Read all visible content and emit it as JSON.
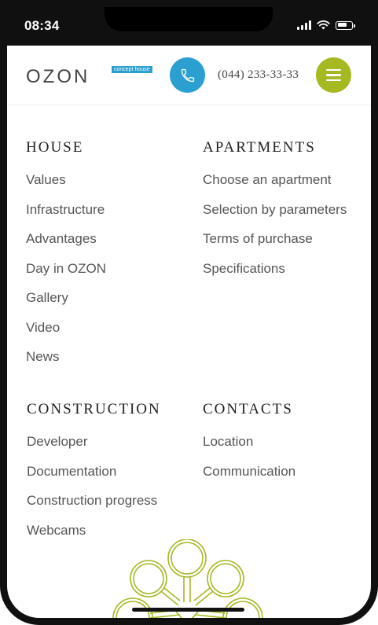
{
  "status_bar": {
    "time": "08:34"
  },
  "header": {
    "logo_text": "OZON",
    "logo_badge": "concept house",
    "phone": "(044) 233-33-33"
  },
  "sections": {
    "house": {
      "title": "HOUSE",
      "items": [
        "Values",
        "Infrastructure",
        "Advantages",
        "Day in OZON",
        "Gallery",
        "Video",
        "News"
      ]
    },
    "apartments": {
      "title": "APARTMENTS",
      "items": [
        "Choose an apartment",
        "Selection by parameters",
        "Terms of purchase",
        "Specifications"
      ]
    },
    "construction": {
      "title": "CONSTRUCTION",
      "items": [
        "Developer",
        "Documentation",
        "Construction progress",
        "Webcams"
      ]
    },
    "contacts": {
      "title": "CONTACTS",
      "items": [
        "Location",
        "Communication"
      ]
    }
  },
  "colors": {
    "brand_blue": "#2a9fd0",
    "brand_green": "#a6b822",
    "decor_green": "#a6b822"
  },
  "icons": {
    "call": "phone-icon",
    "menu": "hamburger-icon",
    "decor": "tree-ornament"
  }
}
